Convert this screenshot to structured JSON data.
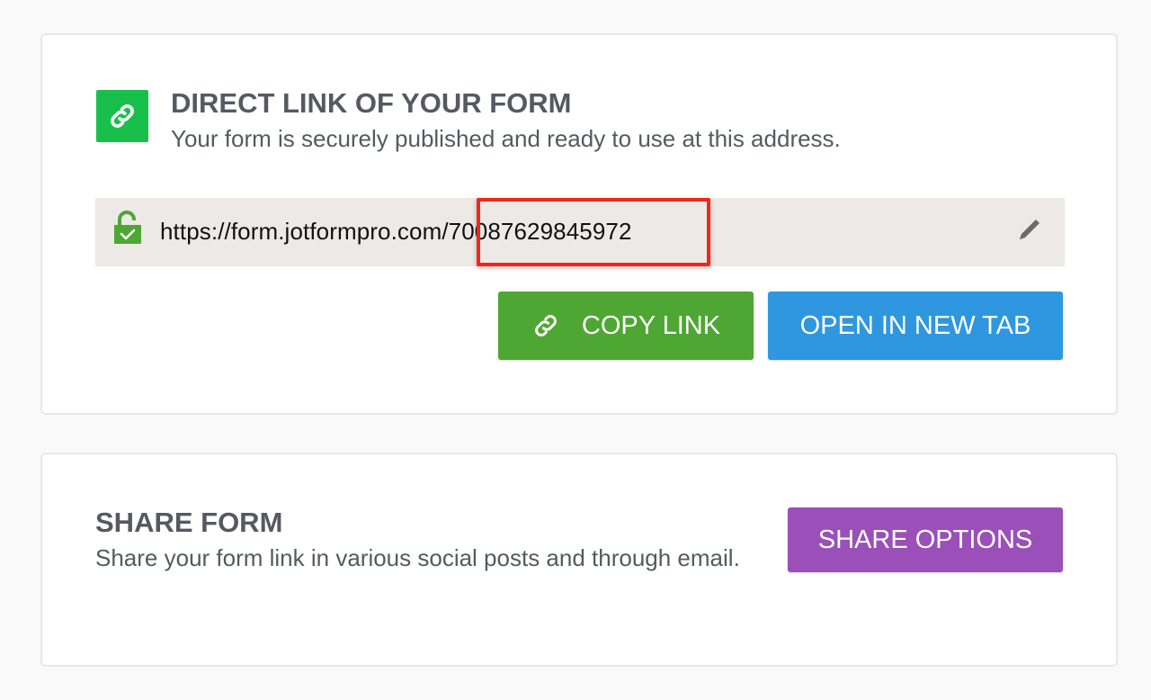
{
  "direct_link": {
    "title": "DIRECT LINK OF YOUR FORM",
    "subtitle": "Your form is securely published and ready to use at this address.",
    "url_prefix": "https://form.jotformpro.com/",
    "url_id": "70087629845972",
    "icons": {
      "header": "link-icon",
      "secure": "lock-icon",
      "edit": "pencil-icon"
    },
    "copy_button": {
      "label": "COPY LINK",
      "icon": "link-icon"
    },
    "open_button": {
      "label": "OPEN IN NEW TAB"
    }
  },
  "share_form": {
    "title": "SHARE FORM",
    "description": "Share your form link in various social posts and through email.",
    "button": {
      "label": "SHARE OPTIONS"
    }
  },
  "colors": {
    "header_icon_bg": "#18c04b",
    "lock_green": "#4ea733",
    "copy_button": "#4ea733",
    "open_button": "#2e97e0",
    "share_button": "#9b4fb8",
    "highlight": "#f0271a",
    "url_bar_bg": "#ede9e6"
  }
}
